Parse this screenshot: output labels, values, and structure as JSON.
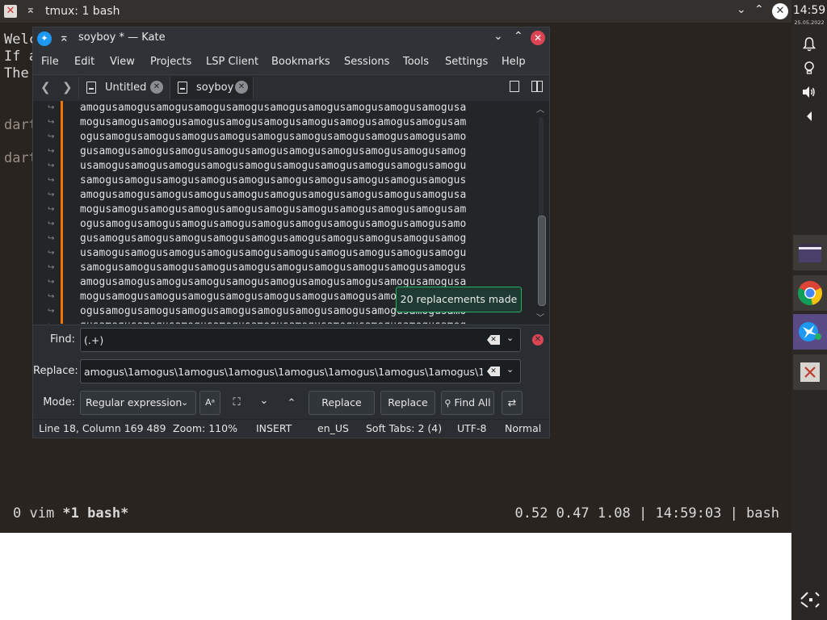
{
  "terminal": {
    "title": "tmux: 1 bash",
    "lines": [
      "Welc",
      "If a",
      "The"
    ],
    "prompt_lines": [
      "dart",
      "dart"
    ],
    "status_left_prefix": "0 vim ",
    "status_left_active": "*1 bash*",
    "status_right": "0.52 0.47 1.08 | 14:59:03 | bash"
  },
  "panel": {
    "time": "14:59",
    "date": "25.05.2022"
  },
  "kate": {
    "title": "soyboy * — Kate",
    "menu": [
      "File",
      "Edit",
      "View",
      "Projects",
      "LSP Client",
      "Bookmarks",
      "Sessions",
      "Tools",
      "Settings",
      "Help"
    ],
    "tabs": [
      {
        "label": "Untitled"
      },
      {
        "label": "soyboy"
      }
    ],
    "editor_lines": [
      "amogusamogusamogusamogusamogusamogusamogusamogusamogusamogusa",
      "mogusamogusamogusamogusamogusamogusamogusamogusamogusamogusam",
      "ogusamogusamogusamogusamogusamogusamogusamogusamogusamogusamo",
      "gusamogusamogusamogusamogusamogusamogusamogusamogusamogusamog",
      "usamogusamogusamogusamogusamogusamogusamogusamogusamogusamogu",
      "samogusamogusamogusamogusamogusamogusamogusamogusamogusamogus",
      "amogusamogusamogusamogusamogusamogusamogusamogusamogusamogusa",
      "mogusamogusamogusamogusamogusamogusamogusamogusamogusamogusam",
      "ogusamogusamogusamogusamogusamogusamogusamogusamogusamogusamo",
      "gusamogusamogusamogusamogusamogusamogusamogusamogusamogusamog",
      "usamogusamogusamogusamogusamogusamogusamogusamogusamogusamogu",
      "samogusamogusamogusamogusamogusamogusamogusamogusamogusamogus",
      "amogusamogusamogusamogusamogusamogusamogusamogusamogusamogusa",
      "mogusamogusamogusamogusamogusamogusamogusamogusamogusamogusam",
      "ogusamogusamogusamogusamogusamogusamogusamogusamogusamogusamo",
      "gusamogusamogusamogusamogusamogusamogusamogusamogusamogusamog"
    ],
    "notification": "20 replacements made",
    "search": {
      "find_label": "Find:",
      "find_value": "(.+)",
      "replace_label": "Replace:",
      "replace_value": "amogus\\1amogus\\1amogus\\1amogus\\1amogus\\1amogus\\1amogus\\1amogus\\1",
      "mode_label": "Mode:",
      "mode_value": "Regular expression",
      "replace_button": "Replace",
      "replace_all_button": "Replace All",
      "find_all_button": "Find All"
    },
    "status": {
      "position": "Line 18, Column 169 489",
      "zoom": "Zoom: 110%",
      "input_mode": "INSERT",
      "dictionary": "en_US",
      "indentation": "Soft Tabs: 2 (4)",
      "encoding": "UTF-8",
      "mode": "Normal"
    }
  },
  "colors": {
    "accent": "#1d99f3",
    "close": "#da4453",
    "modified_bar": "#f67400",
    "toast_border": "#27ae60",
    "active_task": "#5a4a86"
  }
}
